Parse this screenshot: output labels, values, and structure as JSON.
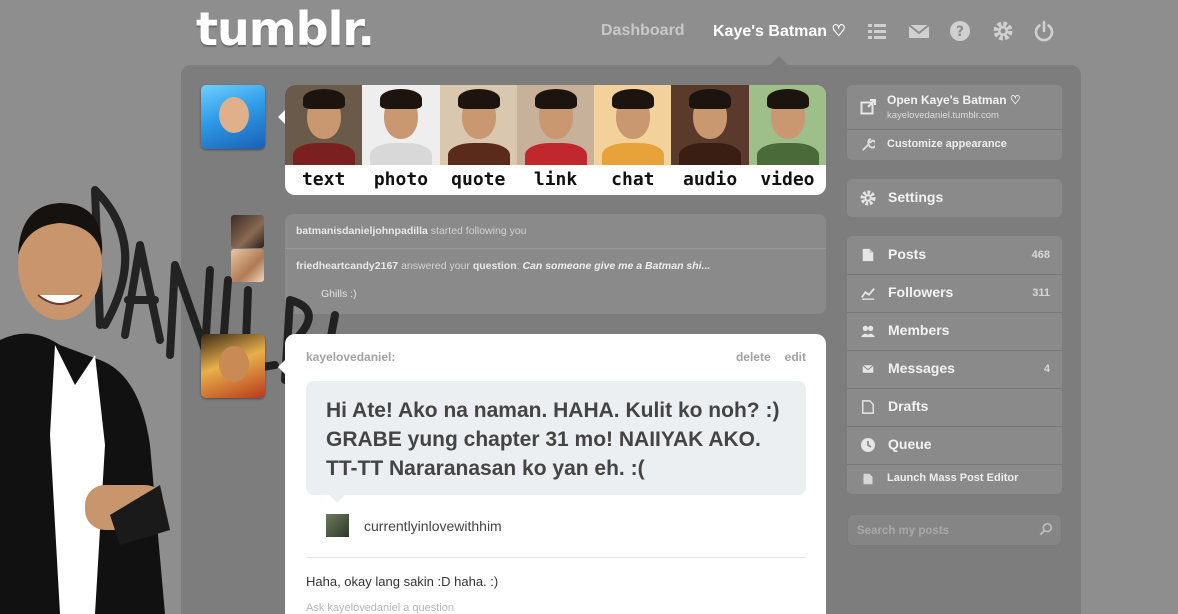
{
  "header": {
    "logo": "tumblr.",
    "nav_dashboard": "Dashboard",
    "nav_blog": "Kaye's Batman ♡",
    "icons": [
      "list-icon",
      "mail-icon",
      "help-icon",
      "gear-icon",
      "power-icon"
    ]
  },
  "post_types": [
    {
      "label": "text",
      "shirt_color": "#7a2020"
    },
    {
      "label": "photo",
      "shirt_color": "#d8d8d8"
    },
    {
      "label": "quote",
      "shirt_color": "#5a2a1a"
    },
    {
      "label": "link",
      "shirt_color": "#c0282e"
    },
    {
      "label": "chat",
      "shirt_color": "#e8a23a"
    },
    {
      "label": "audio",
      "shirt_color": "#3a1e14"
    },
    {
      "label": "video",
      "shirt_color": "#4a6a3a"
    }
  ],
  "activity": {
    "row1": {
      "user": "batmanisdanieljohnpadilla",
      "text": "started following you"
    },
    "row2": {
      "user": "friedheartcandy2167",
      "text": "answered your",
      "kind": "question",
      "question": "Can someone give me a Batman shi..."
    },
    "row3": {
      "text": "Ghills :)"
    }
  },
  "post": {
    "author": "kayelovedaniel:",
    "delete": "delete",
    "edit": "edit",
    "question": "Hi Ate! Ako na naman. HAHA. Kulit ko noh? :) GRABE yung chapter 31 mo! NAIIYAK AKO. TT-TT Nararanasan ko yan eh. :(",
    "asker": "currentlyinlovewithhim",
    "answer": "Haha, okay lang sakin :D haha. :)",
    "ask_link": "Ask kayelovedaniel a question"
  },
  "sidebar": {
    "open_blog": "Open Kaye's Batman ♡",
    "blog_url": "kayelovedaniel.tumblr.com",
    "customize": "Customize appearance",
    "settings": "Settings",
    "items": [
      {
        "label": "Posts",
        "count": "468",
        "icon": "posts-icon"
      },
      {
        "label": "Followers",
        "count": "311",
        "icon": "followers-icon"
      },
      {
        "label": "Members",
        "count": "",
        "icon": "members-icon"
      },
      {
        "label": "Messages",
        "count": "4",
        "icon": "messages-icon"
      },
      {
        "label": "Drafts",
        "count": "",
        "icon": "drafts-icon"
      },
      {
        "label": "Queue",
        "count": "",
        "icon": "queue-icon"
      }
    ],
    "mass_editor": "Launch Mass Post Editor",
    "search_placeholder": "Search my posts"
  },
  "colors": {
    "background": "#8e8e8e",
    "panel": "#7d7d7d",
    "card": "#ffffff",
    "bubble": "#eceff1"
  }
}
